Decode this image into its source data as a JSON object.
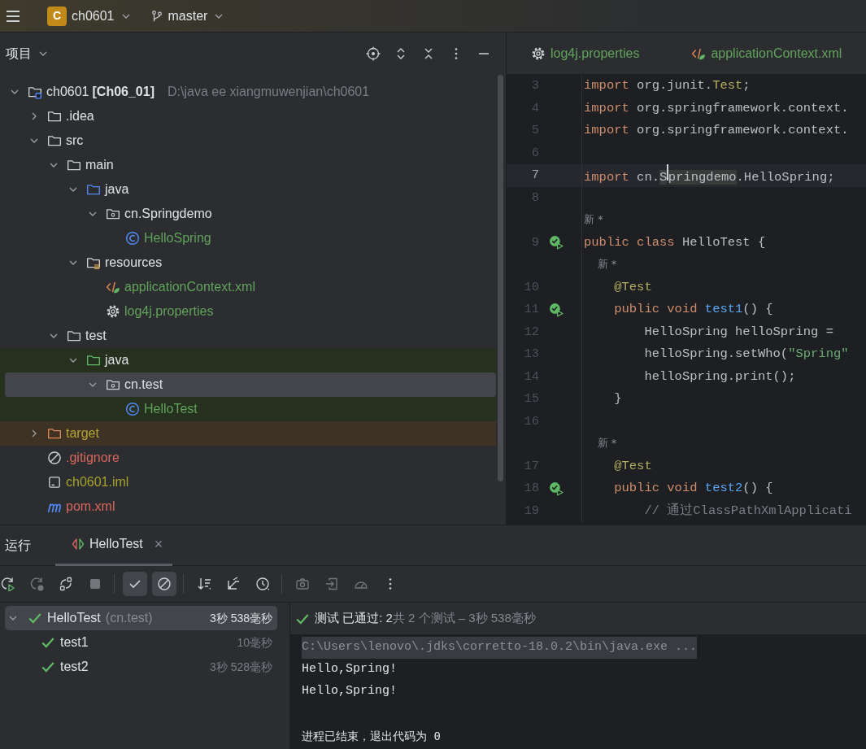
{
  "toolbar": {
    "project_badge": "C",
    "project": "ch0601",
    "branch": "master"
  },
  "project_panel": {
    "title": "项目",
    "tree": [
      {
        "name": "ch0601",
        "suffix": "[Ch06_01]",
        "path": "D:\\java ee xiangmuwenjian\\ch0601",
        "kind": "module",
        "expanded": true,
        "selected": false,
        "children": [
          {
            "name": ".idea",
            "kind": "folder",
            "expanded": false,
            "selected": false
          },
          {
            "name": "src",
            "kind": "folder",
            "expanded": true,
            "selected": false,
            "children": [
              {
                "name": "main",
                "kind": "folder",
                "expanded": true,
                "selected": false,
                "children": [
                  {
                    "name": "java",
                    "kind": "source-folder",
                    "expanded": true,
                    "selected": false,
                    "children": [
                      {
                        "name": "cn.Springdemo",
                        "kind": "package",
                        "expanded": true,
                        "selected": false,
                        "children": [
                          {
                            "name": "HelloSpring",
                            "kind": "class",
                            "color": "#62a35c",
                            "selected": false
                          }
                        ]
                      }
                    ]
                  },
                  {
                    "name": "resources",
                    "kind": "resources",
                    "expanded": true,
                    "selected": false,
                    "children": [
                      {
                        "name": "applicationContext.xml",
                        "kind": "xml",
                        "color": "#62a35c",
                        "selected": false
                      },
                      {
                        "name": "log4j.properties",
                        "kind": "properties",
                        "color": "#62a35c",
                        "selected": false
                      }
                    ]
                  }
                ]
              },
              {
                "name": "test",
                "kind": "folder",
                "expanded": true,
                "selected": false,
                "children": [
                  {
                    "name": "java",
                    "kind": "test-folder",
                    "expanded": true,
                    "selected": false,
                    "children": [
                      {
                        "name": "cn.test",
                        "kind": "package",
                        "expanded": true,
                        "selected": true,
                        "children": [
                          {
                            "name": "HelloTest",
                            "kind": "class",
                            "color": "#62a35c",
                            "selected": false
                          }
                        ]
                      }
                    ]
                  }
                ]
              }
            ]
          },
          {
            "name": "target",
            "kind": "excluded-folder",
            "color": "#b3a336",
            "expanded": false,
            "selected": false
          },
          {
            "name": ".gitignore",
            "kind": "ignore-file",
            "color": "#d9665d",
            "selected": false
          },
          {
            "name": "ch0601.iml",
            "kind": "iml",
            "color": "#a6a22c",
            "selected": false
          },
          {
            "name": "pom.xml",
            "kind": "maven",
            "color": "#d9665d",
            "selected": false
          }
        ]
      }
    ]
  },
  "editor": {
    "tabs": [
      {
        "label": "log4j.properties",
        "kind": "properties",
        "color": "#62a35c",
        "selected": false
      },
      {
        "label": "applicationContext.xml",
        "kind": "xml",
        "color": "#62a35c",
        "selected": false
      }
    ],
    "lines": [
      {
        "kind": "code",
        "number": "3",
        "tokens": [
          {
            "text": "import",
            "kind": "keyword"
          },
          {
            "text": " org.junit.",
            "kind": "plain"
          },
          {
            "text": "Test",
            "kind": "annotation"
          },
          {
            "text": ";",
            "kind": "plain"
          }
        ]
      },
      {
        "kind": "code",
        "number": "4",
        "tokens": [
          {
            "text": "import",
            "kind": "keyword"
          },
          {
            "text": " org.springframework.context.",
            "kind": "plain"
          }
        ]
      },
      {
        "kind": "code",
        "number": "5",
        "tokens": [
          {
            "text": "import",
            "kind": "keyword"
          },
          {
            "text": " org.springframework.context.",
            "kind": "plain"
          }
        ]
      },
      {
        "kind": "code",
        "number": "6"
      },
      {
        "kind": "code",
        "number": "7",
        "current": true,
        "tokens": [
          {
            "text": "import",
            "kind": "keyword"
          },
          {
            "text": " cn.",
            "kind": "plain"
          },
          {
            "text": "S",
            "kind": "highlight"
          },
          {
            "kind": "caret"
          },
          {
            "text": "pringdemo",
            "kind": "highlight"
          },
          {
            "text": ".HelloSpring;",
            "kind": "plain"
          }
        ]
      },
      {
        "kind": "code",
        "number": "8"
      },
      {
        "kind": "hint",
        "tokens": [
          {
            "text": "新 *",
            "kind": "hint"
          }
        ]
      },
      {
        "kind": "code",
        "number": "9",
        "gutter": {
          "kind": "test-passed"
        },
        "tokens": [
          {
            "text": "public class",
            "kind": "keyword"
          },
          {
            "text": " HelloTest {",
            "kind": "plain"
          }
        ]
      },
      {
        "kind": "hint",
        "tokens": [
          {
            "text": "    新 *",
            "kind": "hint"
          }
        ]
      },
      {
        "kind": "code",
        "number": "10",
        "tokens": [
          {
            "text": "    @Test",
            "kind": "annotation"
          }
        ]
      },
      {
        "kind": "code",
        "number": "11",
        "gutter": {
          "kind": "test-passed"
        },
        "tokens": [
          {
            "text": "    public void",
            "kind": "keyword"
          },
          {
            "text": " test1",
            "kind": "function"
          },
          {
            "text": "() {",
            "kind": "plain"
          }
        ]
      },
      {
        "kind": "code",
        "number": "12",
        "tokens": [
          {
            "text": "        HelloSpring helloSpring = ",
            "kind": "plain"
          }
        ]
      },
      {
        "kind": "code",
        "number": "13",
        "tokens": [
          {
            "text": "        helloSpring.setWho(",
            "kind": "plain"
          },
          {
            "text": "\"Spring\"",
            "kind": "string"
          }
        ]
      },
      {
        "kind": "code",
        "number": "14",
        "tokens": [
          {
            "text": "        helloSpring.print();",
            "kind": "plain"
          }
        ]
      },
      {
        "kind": "code",
        "number": "15",
        "tokens": [
          {
            "text": "    }",
            "kind": "plain"
          }
        ]
      },
      {
        "kind": "code",
        "number": "16"
      },
      {
        "kind": "hint",
        "tokens": [
          {
            "text": "    新 *",
            "kind": "hint"
          }
        ]
      },
      {
        "kind": "code",
        "number": "17",
        "tokens": [
          {
            "text": "    @Test",
            "kind": "annotation"
          }
        ]
      },
      {
        "kind": "code",
        "number": "18",
        "gutter": {
          "kind": "test-passed"
        },
        "tokens": [
          {
            "text": "    public void",
            "kind": "keyword"
          },
          {
            "text": " test2",
            "kind": "function"
          },
          {
            "text": "() {",
            "kind": "plain"
          }
        ]
      },
      {
        "kind": "code",
        "number": "19",
        "tokens": [
          {
            "text": "        // 通过ClassPathXmlApplicati",
            "kind": "comment"
          }
        ]
      }
    ]
  },
  "run_panel": {
    "title": "运行",
    "tabs": [
      {
        "label": "HelloTest",
        "close": "×",
        "selected": true
      }
    ],
    "toolbar": [
      {
        "kind": "rerun",
        "on": false,
        "disabled": false
      },
      {
        "kind": "rerun-failed",
        "on": false,
        "disabled": true
      },
      {
        "kind": "toggle-auto",
        "on": false,
        "disabled": false
      },
      {
        "kind": "stop",
        "on": false,
        "disabled": true
      },
      {
        "kind": "separator"
      },
      {
        "kind": "show-passed",
        "on": true,
        "disabled": false
      },
      {
        "kind": "show-ignored",
        "on": true,
        "disabled": false
      },
      {
        "kind": "separator"
      },
      {
        "kind": "sort",
        "on": false,
        "disabled": false
      },
      {
        "kind": "collapse",
        "on": false,
        "disabled": false
      },
      {
        "kind": "history",
        "on": false,
        "disabled": false
      },
      {
        "kind": "separator"
      },
      {
        "kind": "snapshot",
        "on": false,
        "disabled": true
      },
      {
        "kind": "import",
        "on": false,
        "disabled": true
      },
      {
        "kind": "profile",
        "on": false,
        "disabled": true
      },
      {
        "kind": "more",
        "on": false,
        "disabled": false
      }
    ],
    "tests": [
      {
        "name": "HelloTest",
        "detail": "(cn.test)",
        "time": "3秒 538毫秒",
        "passed": true,
        "expanded": true,
        "selected": true,
        "children": [
          {
            "name": "test1",
            "time": "10毫秒",
            "passed": true,
            "selected": false
          },
          {
            "name": "test2",
            "time": "3秒 528毫秒",
            "passed": true,
            "selected": false
          }
        ]
      }
    ],
    "status": {
      "passed": true,
      "summary": "测试 已通过: 2",
      "detail": "共 2 个测试 – 3秒 538毫秒"
    },
    "console": [
      {
        "kind": "command",
        "text": "C:\\Users\\lenovo\\.jdks\\corretto-18.0.2\\bin\\java.exe ..."
      },
      {
        "kind": "output",
        "text": "Hello,Spring!"
      },
      {
        "kind": "output",
        "text": "Hello,Spring!"
      },
      {
        "kind": "exit",
        "text": "进程已结束，退出代码为 0"
      }
    ]
  }
}
